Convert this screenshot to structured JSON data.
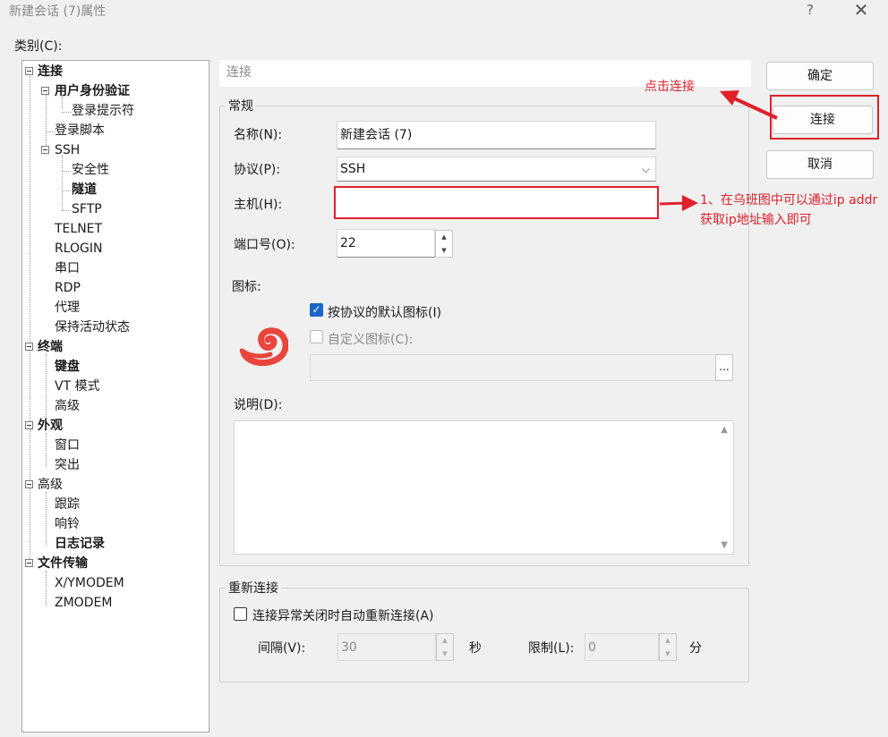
{
  "window": {
    "title": "新建会话 (7)属性",
    "help_label": "?",
    "close_label": "✕"
  },
  "category_label": "类别(C):",
  "tree": {
    "items": [
      {
        "label": "连接"
      },
      {
        "label": "用户身份验证"
      },
      {
        "label": "登录提示符"
      },
      {
        "label": "登录脚本"
      },
      {
        "label": "SSH"
      },
      {
        "label": "安全性"
      },
      {
        "label": "隧道"
      },
      {
        "label": "SFTP"
      },
      {
        "label": "TELNET"
      },
      {
        "label": "RLOGIN"
      },
      {
        "label": "串口"
      },
      {
        "label": "RDP"
      },
      {
        "label": "代理"
      },
      {
        "label": "保持活动状态"
      },
      {
        "label": "终端"
      },
      {
        "label": "键盘"
      },
      {
        "label": "VT 模式"
      },
      {
        "label": "高级"
      },
      {
        "label": "外观"
      },
      {
        "label": "窗口"
      },
      {
        "label": "突出"
      },
      {
        "label": "高级"
      },
      {
        "label": "跟踪"
      },
      {
        "label": "响铃"
      },
      {
        "label": "日志记录"
      },
      {
        "label": "文件传输"
      },
      {
        "label": "X/YMODEM"
      },
      {
        "label": "ZMODEM"
      }
    ]
  },
  "section_header": "连接",
  "general": {
    "group_title": "常规",
    "name_label": "名称(N):",
    "name_value": "新建会话 (7)",
    "protocol_label": "协议(P):",
    "protocol_value": "SSH",
    "host_label": "主机(H):",
    "host_value": "",
    "port_label": "端口号(O):",
    "port_value": "22",
    "icon_label": "图标:",
    "default_icon_label": "按协议的默认图标(I)",
    "custom_icon_label": "自定义图标(C):",
    "icon_path_value": "",
    "browse_label": "...",
    "description_label": "说明(D):",
    "description_value": ""
  },
  "reconnect": {
    "group_title": "重新连接",
    "auto_label": "连接异常关闭时自动重新连接(A)",
    "interval_label": "间隔(V):",
    "interval_value": "30",
    "seconds_label": "秒",
    "limit_label": "限制(L):",
    "limit_value": "0",
    "minutes_label": "分"
  },
  "buttons": {
    "ok": "确定",
    "connect": "连接",
    "cancel": "取消"
  },
  "annotations": {
    "click_connect": "点击连接",
    "host_hint_line1": "1、在乌班图中可以通过ip addr",
    "host_hint_line2": "获取ip地址输入即可"
  },
  "colors": {
    "annotation_red": "#e0202a",
    "checkbox_blue": "#1a66c6",
    "icon_red": "#e8453c"
  }
}
